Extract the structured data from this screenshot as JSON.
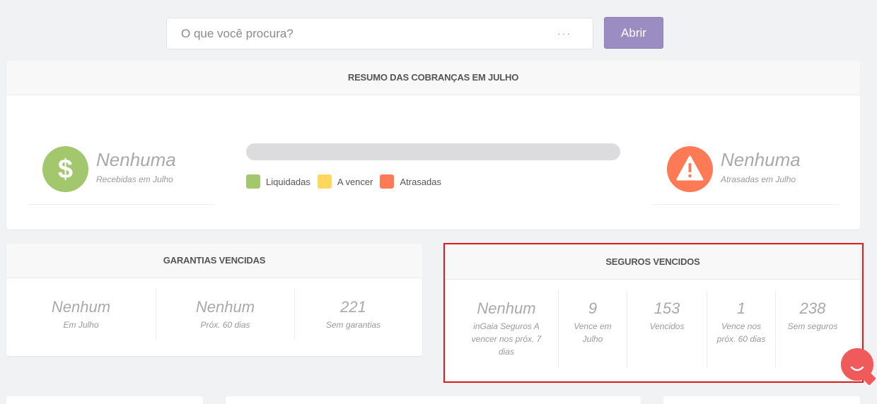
{
  "search": {
    "placeholder": "O que você procura?",
    "dots": "···",
    "button_label": "Abrir"
  },
  "summary": {
    "title": "RESUMO DAS COBRANÇAS EM JULHO",
    "received": {
      "value": "Nenhuma",
      "label": "Recebidas em Julho",
      "icon": "dollar-icon",
      "color": "#a2c76d"
    },
    "overdue": {
      "value": "Nenhuma",
      "label": "Atrasadas em Julho",
      "icon": "warning-icon",
      "color": "#fe7a55"
    },
    "legend": [
      {
        "label": "Liquidadas",
        "color": "#a2c76d"
      },
      {
        "label": "A vencer",
        "color": "#ffd75d"
      },
      {
        "label": "Atrasadas",
        "color": "#fe7a55"
      }
    ]
  },
  "guarantees": {
    "title": "GARANTIAS VENCIDAS",
    "items": [
      {
        "value": "Nenhum",
        "label": "Em Julho"
      },
      {
        "value": "Nenhum",
        "label": "Próx. 60 dias"
      },
      {
        "value": "221",
        "label": "Sem garantias"
      }
    ]
  },
  "insurance": {
    "title": "SEGUROS VENCIDOS",
    "items": [
      {
        "value": "Nenhum",
        "label": "inGaia Seguros A vencer nos próx. 7 dias"
      },
      {
        "value": "9",
        "label": "Vence em Julho"
      },
      {
        "value": "153",
        "label": "Vencidos"
      },
      {
        "value": "1",
        "label": "Vence nos próx. 60 dias"
      },
      {
        "value": "238",
        "label": "Sem seguros"
      }
    ]
  }
}
